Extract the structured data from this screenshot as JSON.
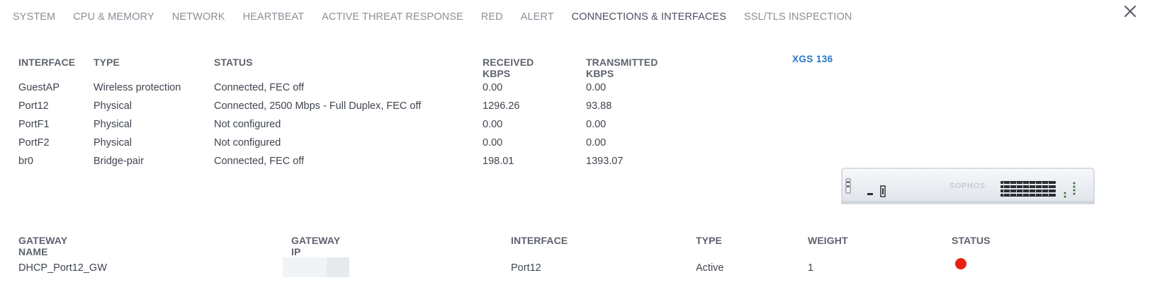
{
  "tabs": [
    {
      "label": "SYSTEM",
      "active": false
    },
    {
      "label": "CPU & MEMORY",
      "active": false
    },
    {
      "label": "NETWORK",
      "active": false
    },
    {
      "label": "HEARTBEAT",
      "active": false
    },
    {
      "label": "ACTIVE THREAT RESPONSE",
      "active": false
    },
    {
      "label": "RED",
      "active": false
    },
    {
      "label": "ALERT",
      "active": false
    },
    {
      "label": "CONNECTIONS & INTERFACES",
      "active": true
    },
    {
      "label": "SSL/TLS INSPECTION",
      "active": false
    }
  ],
  "close_icon": "close-icon",
  "interfaces": {
    "headers": {
      "interface": "INTERFACE",
      "type": "TYPE",
      "status": "STATUS",
      "received": "RECEIVED KBPS",
      "transmitted": "TRANSMITTED KBPS"
    },
    "rows": [
      {
        "interface": "GuestAP",
        "type": "Wireless protection",
        "status": "Connected, FEC off",
        "received": "0.00",
        "transmitted": "0.00"
      },
      {
        "interface": "Port12",
        "type": "Physical",
        "status": "Connected, 2500 Mbps - Full Duplex, FEC off",
        "received": "1296.26",
        "transmitted": "93.88"
      },
      {
        "interface": "PortF1",
        "type": "Physical",
        "status": "Not configured",
        "received": "0.00",
        "transmitted": "0.00"
      },
      {
        "interface": "PortF2",
        "type": "Physical",
        "status": "Not configured",
        "received": "0.00",
        "transmitted": "0.00"
      },
      {
        "interface": "br0",
        "type": "Bridge-pair",
        "status": "Connected, FEC off",
        "received": "198.01",
        "transmitted": "1393.07"
      }
    ]
  },
  "device": {
    "model": "XGS 136",
    "brand": "SOPHOS"
  },
  "gateways": {
    "headers": {
      "name": "GATEWAY NAME",
      "ip": "GATEWAY IP",
      "interface": "INTERFACE",
      "type": "TYPE",
      "weight": "WEIGHT",
      "status": "STATUS"
    },
    "rows": [
      {
        "name": "DHCP_Port12_GW",
        "ip": "",
        "interface": "Port12",
        "type": "Active",
        "weight": "1",
        "status_color": "#e8210f"
      }
    ]
  },
  "colors": {
    "accent": "#2a74c9",
    "status_down": "#e8210f"
  }
}
